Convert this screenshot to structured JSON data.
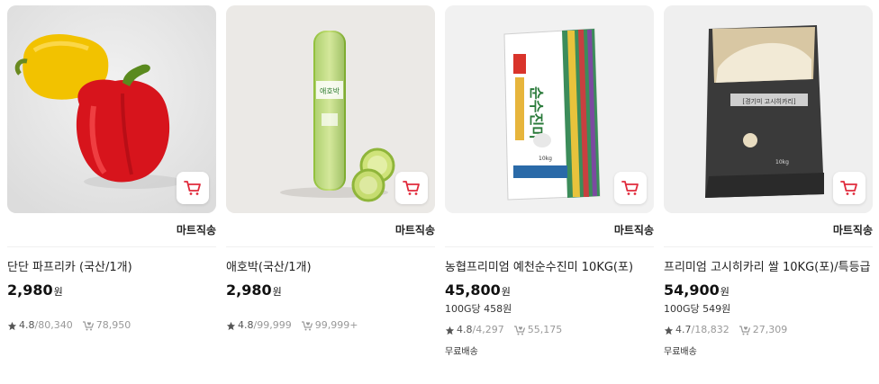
{
  "products": [
    {
      "name": "단단 파프리카 (국산/1개)",
      "price": "2,980",
      "currency": "원",
      "delivery_tag": "마트직송",
      "rating": "4.8",
      "reviews": "/80,340",
      "likes": "78,950",
      "image_icon": "bell-pepper-image"
    },
    {
      "name": "애호박(국산/1개)",
      "price": "2,980",
      "currency": "원",
      "delivery_tag": "마트직송",
      "rating": "4.8",
      "reviews": "/99,999",
      "likes": "99,999+",
      "image_icon": "zucchini-image",
      "package_label": "애호박"
    },
    {
      "name": "농협프리미엄 예천순수진미 10KG(포)",
      "price": "45,800",
      "currency": "원",
      "unit_price": "100G당 458원",
      "delivery_tag": "마트직송",
      "rating": "4.8",
      "reviews": "/4,297",
      "likes": "55,175",
      "shipping": "무료배송",
      "image_icon": "rice-bag-image",
      "package_label": "순수진미",
      "package_weight": "10kg"
    },
    {
      "name": "프리미엄 고시히카리 쌀 10KG(포)/특등급",
      "price": "54,900",
      "currency": "원",
      "unit_price": "100G당 549원",
      "delivery_tag": "마트직송",
      "rating": "4.7",
      "reviews": "/18,832",
      "likes": "27,309",
      "shipping": "무료배송",
      "image_icon": "rice-bag-image",
      "package_label": "[경기미 고시히카리]",
      "package_weight": "10kg"
    }
  ],
  "colors": {
    "cart_red": "#e02b3c",
    "star": "#555555",
    "thumb_bg": "#eeeeee"
  },
  "icons": {
    "cart": "cart-icon",
    "star": "star-icon",
    "like": "heart-cart-icon"
  }
}
